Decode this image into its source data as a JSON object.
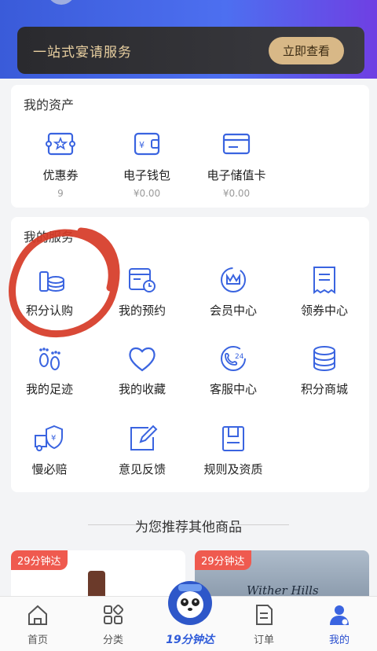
{
  "banner": {
    "title": "一站式宴请服务",
    "button": "立即查看"
  },
  "assets": {
    "title": "我的资产",
    "items": [
      {
        "icon": "coupon-icon",
        "label": "优惠券",
        "value": "9"
      },
      {
        "icon": "wallet-icon",
        "label": "电子钱包",
        "value": "¥0.00"
      },
      {
        "icon": "stored-value-card-icon",
        "label": "电子储值卡",
        "value": "¥0.00"
      }
    ]
  },
  "services": {
    "title": "我的服务",
    "items": [
      {
        "icon": "points-purchase-icon",
        "label": "积分认购"
      },
      {
        "icon": "reservation-icon",
        "label": "我的预约"
      },
      {
        "icon": "member-center-icon",
        "label": "会员中心"
      },
      {
        "icon": "coupon-center-icon",
        "label": "领券中心"
      },
      {
        "icon": "footprint-icon",
        "label": "我的足迹"
      },
      {
        "icon": "heart-icon",
        "label": "我的收藏"
      },
      {
        "icon": "customer-service-icon",
        "label": "客服中心"
      },
      {
        "icon": "points-mall-icon",
        "label": "积分商城"
      },
      {
        "icon": "slow-compensation-icon",
        "label": "慢必赔"
      },
      {
        "icon": "feedback-icon",
        "label": "意见反馈"
      },
      {
        "icon": "rules-qualification-icon",
        "label": "规则及资质"
      }
    ]
  },
  "recommend": {
    "title": "为您推荐其他商品",
    "products": [
      {
        "tag": "29分钟达"
      },
      {
        "tag": "29分钟达",
        "label_text": "Wither Hills"
      }
    ]
  },
  "tabbar": {
    "items": [
      {
        "icon": "home-icon",
        "label": "首页"
      },
      {
        "icon": "category-icon",
        "label": "分类"
      },
      {
        "icon": "express-mascot-icon",
        "label": "19分钟达"
      },
      {
        "icon": "order-icon",
        "label": "订单"
      },
      {
        "icon": "profile-icon",
        "label": "我的"
      }
    ],
    "active": "我的"
  },
  "colors": {
    "accent": "#3a64e0",
    "tag": "#ef5a4f",
    "banner_gold": "#d8b887"
  }
}
